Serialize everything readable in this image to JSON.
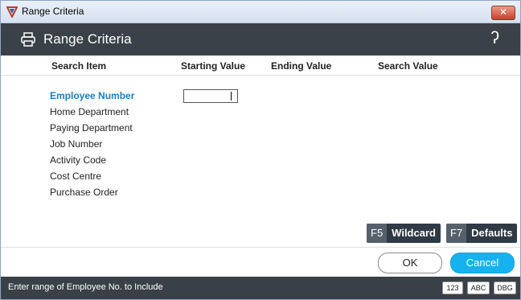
{
  "window": {
    "title": "Range Criteria"
  },
  "header": {
    "title": "Range Criteria"
  },
  "columns": {
    "search_item": "Search Item",
    "starting_value": "Starting Value",
    "ending_value": "Ending Value",
    "search_value": "Search Value"
  },
  "items": [
    {
      "label": "Employee Number",
      "selected": true
    },
    {
      "label": "Home Department"
    },
    {
      "label": "Paying Department"
    },
    {
      "label": "Job Number"
    },
    {
      "label": "Activity Code"
    },
    {
      "label": "Cost Centre"
    },
    {
      "label": "Purchase Order"
    }
  ],
  "start_value": "",
  "function_buttons": [
    {
      "key": "F5",
      "label": "Wildcard"
    },
    {
      "key": "F7",
      "label": "Defaults"
    }
  ],
  "buttons": {
    "ok": "OK",
    "cancel": "Cancel"
  },
  "status": {
    "message": "Enter range of Employee No. to Include",
    "indicators": [
      "123",
      "ABC",
      "DBG"
    ]
  },
  "colors": {
    "header_bg": "#3b4148",
    "accent": "#15b2ef",
    "selected_item": "#1a7dc0"
  },
  "icons": [
    "app-logo-icon",
    "close-icon",
    "print-icon",
    "help-icon"
  ]
}
